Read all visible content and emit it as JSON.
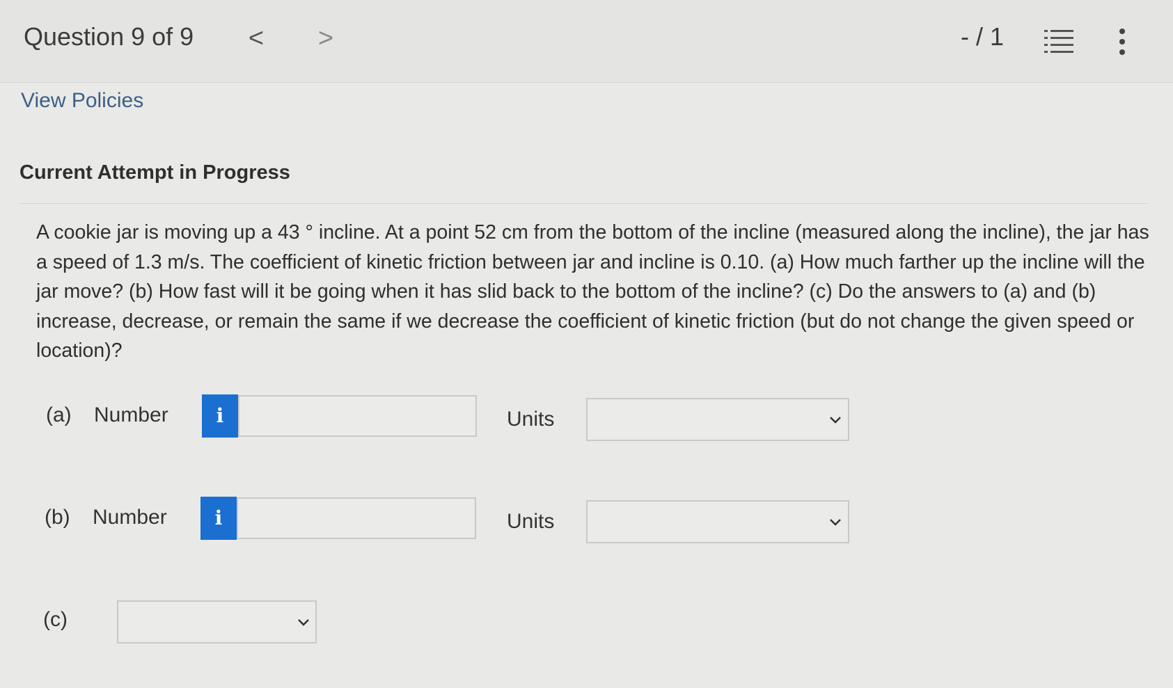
{
  "header": {
    "question_label": "Question 9 of 9",
    "prev_glyph": "<",
    "next_glyph": ">",
    "score": "- / 1",
    "icons": [
      "list-icon",
      "kebab-menu-icon"
    ]
  },
  "policies_link": "View Policies",
  "attempt_title": "Current Attempt in Progress",
  "problem_text": "A cookie jar is moving up a 43 ° incline. At a point 52 cm from the bottom of the incline (measured along the incline), the jar has a speed of 1.3 m/s. The coefficient of kinetic friction between jar and incline is 0.10. (a) How much farther up the incline will the jar move? (b) How fast will it be going when it has slid back to the bottom of the incline? (c) Do the answers to (a) and (b) increase, decrease, or remain the same if we decrease the coefficient of kinetic friction (but do not change the given speed or location)?",
  "parts": {
    "a": {
      "label": "(a)",
      "number_label": "Number",
      "info_glyph": "i",
      "value": "",
      "units_label": "Units",
      "units_value": ""
    },
    "b": {
      "label": "(b)",
      "number_label": "Number",
      "info_glyph": "i",
      "value": "",
      "units_label": "Units",
      "units_value": ""
    },
    "c": {
      "label": "(c)",
      "value": ""
    }
  },
  "colors": {
    "info_button": "#1a6fd1",
    "link": "#3e5f86",
    "background": "#e9e9e7"
  }
}
